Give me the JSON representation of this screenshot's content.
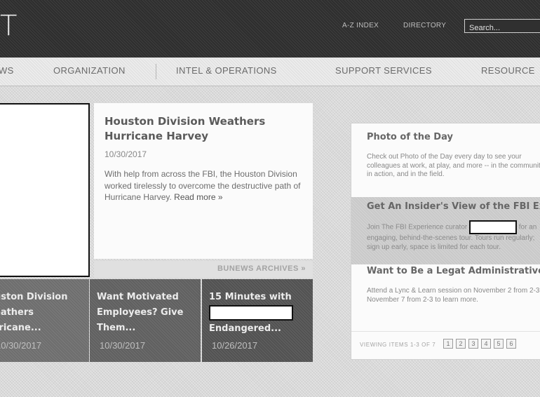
{
  "header": {
    "logo_fragment": "T",
    "utility_links": [
      "A-Z INDEX",
      "DIRECTORY"
    ],
    "search_placeholder": "Search..."
  },
  "nav": {
    "items": [
      "WS",
      "ORGANIZATION",
      "INTEL & OPERATIONS",
      "SUPPORT SERVICES",
      "RESOURCE"
    ]
  },
  "featured": {
    "title": "Houston Division Weathers Hurricane Harvey",
    "date": "10/30/2017",
    "body": "With help from across the FBI, the Houston Division worked tirelessly to overcome the destructive path of Hurricane Harvey.",
    "read_more": "Read more »",
    "archives_link": "BUNEWS ARCHIVES »"
  },
  "thumbnails": [
    {
      "title": "uston Division eathers rricane...",
      "date": "10/30/2017"
    },
    {
      "title": "Want Motivated Employees? Give Them...",
      "date": "10/30/2017"
    },
    {
      "title_before": "15 Minutes with",
      "title_after": "Endangered...",
      "date": "10/26/2017"
    }
  ],
  "sidebar": {
    "items": [
      {
        "title": "Photo of the Day",
        "text": "Check out Photo of the Day every day to see your colleagues at work, at play, and more -- in the community, in action, and in the field."
      },
      {
        "title": "Get An Insider's View of the FBI Experience",
        "text_before": "Join The FBI Experience curator",
        "text_after": "for an engaging, behind-the-scenes tour. Tours run regularly; sign up early, space is limited for each tour."
      },
      {
        "title": "Want to Be a Legat Administrative Specialist?",
        "text": "Attend a Lync & Learn session on November 2 from 2-3 or November 7 from 2-3 to learn more."
      }
    ],
    "footer_label": "VIEWING ITEMS 1-3 OF 7",
    "pages": [
      "1",
      "2",
      "3",
      "4",
      "5",
      "6"
    ]
  }
}
